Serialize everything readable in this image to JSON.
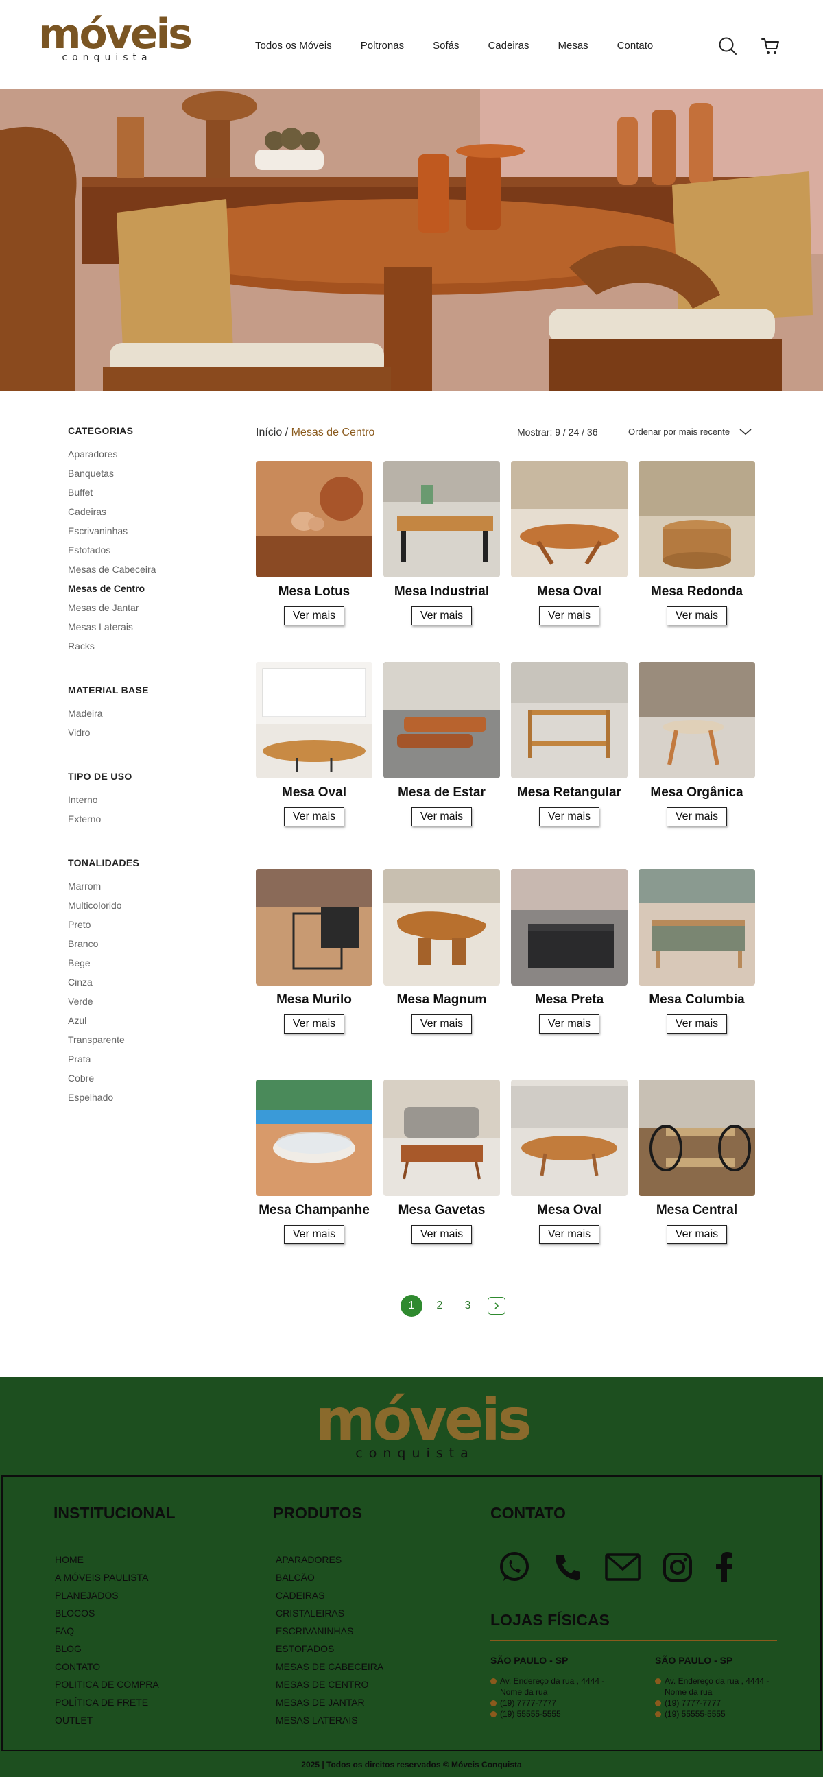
{
  "brand": {
    "name": "móveis",
    "tagline": "conquista"
  },
  "nav": [
    "Todos os Móveis",
    "Poltronas",
    "Sofás",
    "Cadeiras",
    "Mesas",
    "Contato"
  ],
  "sidebar": {
    "categories": {
      "title": "CATEGORIAS",
      "items": [
        "Aparadores",
        "Banquetas",
        "Buffet",
        "Cadeiras",
        "Escrivaninhas",
        "Estofados",
        "Mesas de Cabeceira",
        "Mesas de Centro",
        "Mesas de Jantar",
        "Mesas Laterais",
        "Racks"
      ],
      "active": "Mesas de Centro"
    },
    "material": {
      "title": "MATERIAL BASE",
      "items": [
        "Madeira",
        "Vidro"
      ]
    },
    "usage": {
      "title": "TIPO DE USO",
      "items": [
        "Interno",
        "Externo"
      ]
    },
    "tones": {
      "title": "TONALIDADES",
      "items": [
        "Marrom",
        "Multicolorido",
        "Preto",
        "Branco",
        "Bege",
        "Cinza",
        "Verde",
        "Azul",
        "Transparente",
        "Prata",
        "Cobre",
        "Espelhado"
      ]
    }
  },
  "breadcrumb": {
    "home": "Início",
    "separator": " / ",
    "current": "Mesas de Centro"
  },
  "toolbar": {
    "show_label": "Mostrar: 9 / 24 / 36",
    "sort_label": "Ordenar por mais recente"
  },
  "products": [
    {
      "name": "Mesa Lotus",
      "button": "Ver mais"
    },
    {
      "name": "Mesa Industrial",
      "button": "Ver mais"
    },
    {
      "name": "Mesa Oval",
      "button": "Ver mais"
    },
    {
      "name": "Mesa Redonda",
      "button": "Ver mais"
    },
    {
      "name": "Mesa Oval",
      "button": "Ver mais"
    },
    {
      "name": "Mesa de Estar",
      "button": "Ver mais"
    },
    {
      "name": "Mesa Retangular",
      "button": "Ver mais"
    },
    {
      "name": "Mesa Orgânica",
      "button": "Ver mais"
    },
    {
      "name": "Mesa Murilo",
      "button": "Ver mais"
    },
    {
      "name": "Mesa Magnum",
      "button": "Ver mais"
    },
    {
      "name": "Mesa Preta",
      "button": "Ver mais"
    },
    {
      "name": "Mesa Columbia",
      "button": "Ver mais"
    },
    {
      "name": "Mesa Champanhe",
      "button": "Ver mais"
    },
    {
      "name": "Mesa Gavetas",
      "button": "Ver mais"
    },
    {
      "name": "Mesa Oval",
      "button": "Ver mais"
    },
    {
      "name": "Mesa Central",
      "button": "Ver mais"
    }
  ],
  "pagination": {
    "pages": [
      "1",
      "2",
      "3"
    ],
    "current": "1"
  },
  "footer": {
    "institucional": {
      "title": "INSTITUCIONAL",
      "links": [
        "HOME",
        "A MÓVEIS PAULISTA",
        "PLANEJADOS",
        "BLOCOS",
        "FAQ",
        "BLOG",
        "CONTATO",
        "POLÍTICA DE COMPRA",
        "POLÍTICA DE FRETE",
        "OUTLET"
      ]
    },
    "produtos": {
      "title": "PRODUTOS",
      "links": [
        "APARADORES",
        "BALCÃO",
        "CADEIRAS",
        "CRISTALEIRAS",
        "ESCRIVANINHAS",
        "ESTOFADOS",
        "MESAS DE CABECEIRA",
        "MESAS DE CENTRO",
        "MESAS DE JANTAR",
        "MESAS LATERAIS"
      ]
    },
    "contato": {
      "title": "CONTATO",
      "icons": [
        "whatsapp-icon",
        "phone-icon",
        "mail-icon",
        "instagram-icon",
        "facebook-icon"
      ]
    },
    "lojas": {
      "title": "LOJAS FÍSICAS",
      "stores": [
        {
          "city": "SÃO PAULO - SP",
          "address": "Av. Endereço da rua , 4444 - Nome da rua",
          "phone1": "(19) 7777-7777",
          "phone2": "(19) 55555-5555"
        },
        {
          "city": "SÃO PAULO - SP",
          "address": "Av. Endereço da rua , 4444 - Nome da rua",
          "phone1": "(19) 7777-7777",
          "phone2": "(19) 55555-5555"
        }
      ]
    },
    "copyright": "2025 | Todos os direitos reservados © Móveis Conquista"
  },
  "colors": {
    "brand_brown": "#7a5523",
    "footer_green": "#1d4f1f",
    "pagination_green": "#2f8a2f"
  }
}
